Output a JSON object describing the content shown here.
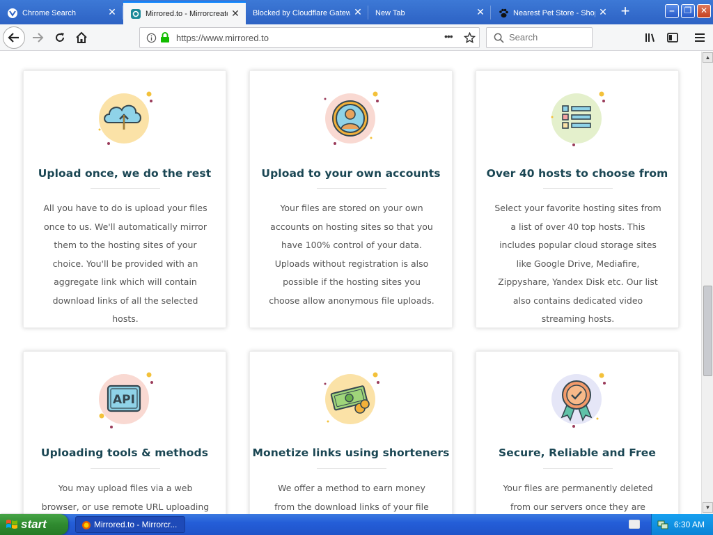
{
  "browser": {
    "tabs": [
      {
        "title": "Chrome Search",
        "active": false
      },
      {
        "title": "Mirrored.to - Mirrorcreator",
        "active": true
      },
      {
        "title": "Blocked by Cloudflare Gateway",
        "active": false
      },
      {
        "title": "New Tab",
        "active": false
      },
      {
        "title": "Nearest Pet Store - Shop",
        "active": false
      }
    ],
    "new_tab_label": "+",
    "url": "https://www.mirrored.to",
    "search_placeholder": "Search",
    "window_controls": {
      "minimize": "‒",
      "restore": "❐",
      "close": "✕"
    }
  },
  "features": [
    {
      "icon": "cloud-upload-icon",
      "title": "Upload once, we do the rest",
      "text": "All you have to do is upload your files once to us. We'll automatically mirror them to the hosting sites of your choice. You'll be provided with an aggregate link which will contain download links of all the selected hosts."
    },
    {
      "icon": "user-account-icon",
      "title": "Upload to your own accounts",
      "text": "Your files are stored on your own accounts on hosting sites so that you have 100% control of your data. Uploads without registration is also possible if the hosting sites you choose allow anonymous file uploads."
    },
    {
      "icon": "checklist-icon",
      "title": "Over 40 hosts to choose from",
      "text": "Select your favorite hosting sites from a list of over 40 top hosts. This includes popular cloud storage sites like Google Drive, Mediafire, Zippyshare, Yandex Disk etc. Our list also contains dedicated video streaming hosts."
    },
    {
      "icon": "api-icon",
      "icon_text": "API",
      "title": "Uploading tools & methods",
      "text": "You may upload files via a web browser, or use remote URL uploading where you"
    },
    {
      "icon": "money-icon",
      "title": "Monetize links using shorteners",
      "text": "We offer a method to earn money from the download links of your file using URL"
    },
    {
      "icon": "award-badge-icon",
      "title": "Secure, Reliable and Free",
      "text": "Your files are permanently deleted from our servers once they are uploaded to"
    }
  ],
  "taskbar": {
    "start_label": "start",
    "items": [
      {
        "title": "Mirrored.to - Mirrorcr..."
      }
    ],
    "clock": "6:30 AM"
  }
}
